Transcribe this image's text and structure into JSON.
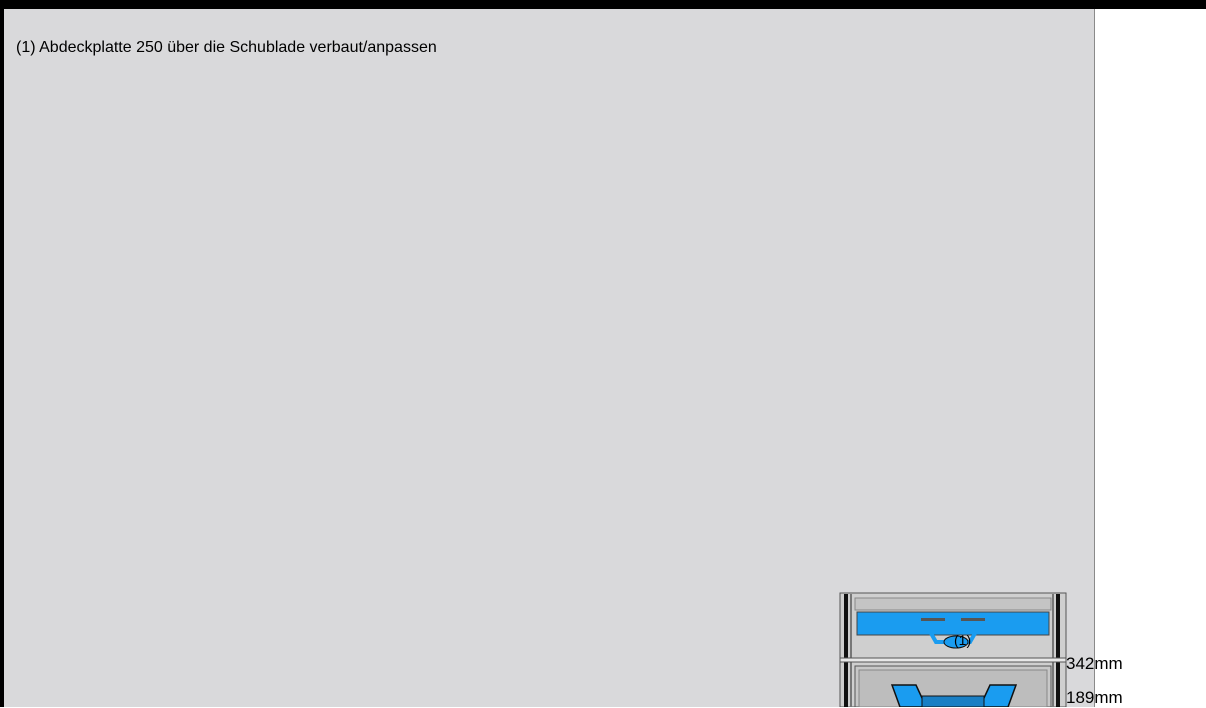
{
  "instruction": {
    "text": "(1) Abdeckplatte 250 über die Schublade verbaut/anpassen"
  },
  "drawing": {
    "marker_label": "(1)",
    "dimensions": [
      "342mm",
      "189mm"
    ],
    "colors": {
      "highlight_blue": "#1a9cf0",
      "frame_dark": "#111111",
      "panel_gray": "#c8c8c8",
      "background": "#d9d9db"
    }
  }
}
